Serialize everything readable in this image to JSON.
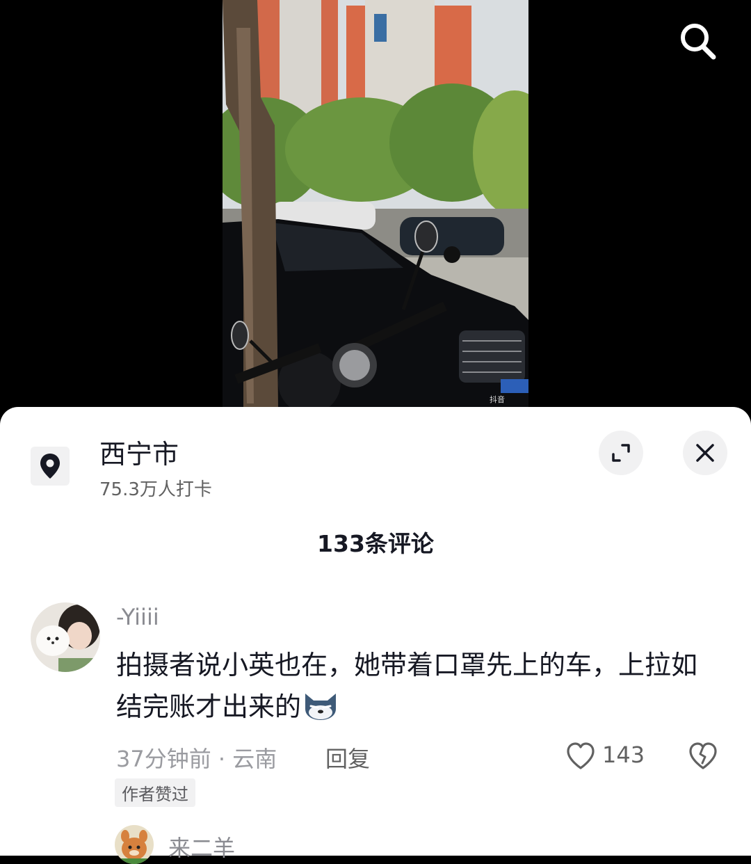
{
  "video": {
    "watermark": "抖音"
  },
  "location": {
    "name": "西宁市",
    "checkins": "75.3万人打卡"
  },
  "comments_header": {
    "title": "133条评论"
  },
  "comments": [
    {
      "username": "-Yiiii",
      "text": "拍摄者说小英也在，她带着口罩先上的车，上拉如结完账才出来的",
      "meta": "37分钟前 · 云南",
      "reply_label": "回复",
      "likes": "143",
      "badge": "作者赞过"
    },
    {
      "username": "来二羊"
    }
  ],
  "icons": {
    "search": "search-icon",
    "location": "location-pin-icon",
    "expand": "expand-icon",
    "close": "close-icon",
    "like": "heart-icon",
    "dislike": "broken-heart-icon",
    "emoji": "fox-emoji-icon"
  }
}
